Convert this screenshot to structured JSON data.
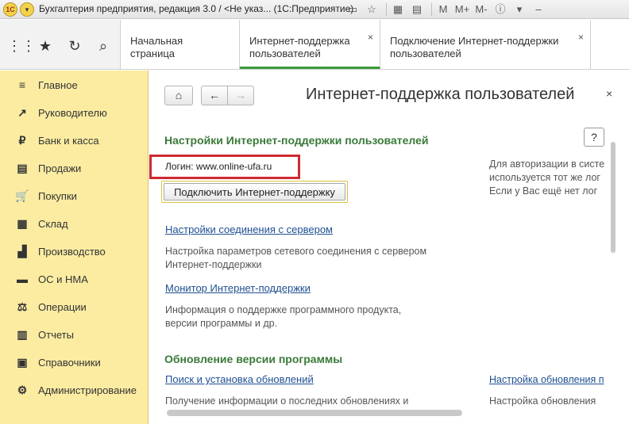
{
  "titlebar": {
    "title": "Бухгалтерия предприятия, редакция 3.0 / <Не указ... (1С:Предприятие)",
    "logo_text": "1С",
    "icons": [
      "window-icon",
      "star-icon",
      "calculator-icon",
      "calendar-icon",
      "memory-icon",
      "info-icon",
      "dropdown-icon",
      "minimize-icon",
      "restore-icon",
      "close-icon"
    ],
    "memory_labels": [
      "M",
      "M+",
      "M-"
    ]
  },
  "tabs": [
    {
      "label": "Начальная страница"
    },
    {
      "label": "Интернет-поддержка пользователей",
      "close": "×"
    },
    {
      "label": "Подключение Интернет-поддержки пользователей",
      "close": "×"
    }
  ],
  "sidebar": {
    "items": [
      {
        "label": "Главное",
        "icon": "≡"
      },
      {
        "label": "Руководителю",
        "icon": "↗"
      },
      {
        "label": "Банк и касса",
        "icon": "₽"
      },
      {
        "label": "Продажи",
        "icon": "▤"
      },
      {
        "label": "Покупки",
        "icon": "🛒"
      },
      {
        "label": "Склад",
        "icon": "▦"
      },
      {
        "label": "Производство",
        "icon": "▟"
      },
      {
        "label": "ОС и НМА",
        "icon": "▬"
      },
      {
        "label": "Операции",
        "icon": "⚖"
      },
      {
        "label": "Отчеты",
        "icon": "▥"
      },
      {
        "label": "Справочники",
        "icon": "▣"
      },
      {
        "label": "Администрирование",
        "icon": "⚙"
      }
    ]
  },
  "main": {
    "page_title": "Интернет-поддержка пользователей",
    "close": "×",
    "help": "?",
    "settings_title": "Настройки Интернет-поддержки пользователей",
    "login_text": "Логин: www.online-ufa.ru",
    "connect_button": "Подключить Интернет-поддержку",
    "right_info": [
      "Для авторизации в систе",
      "используется тот же лог",
      "Если у Вас ещё нет лог"
    ],
    "link1": "Настройки соединения с сервером",
    "desc1": [
      "Настройка параметров сетевого соединения с сервером",
      "Интернет-поддержки"
    ],
    "link2": "Монитор Интернет-поддержки",
    "desc2": [
      "Информация о поддержке программного продукта,",
      "версии программы и др."
    ],
    "update_title": "Обновление версии программы",
    "link3": "Поиск и установка обновлений",
    "desc3": "Получение информации о последних обновлениях и",
    "link4": "Настройка обновления п",
    "desc4": "Настройка обновления"
  }
}
